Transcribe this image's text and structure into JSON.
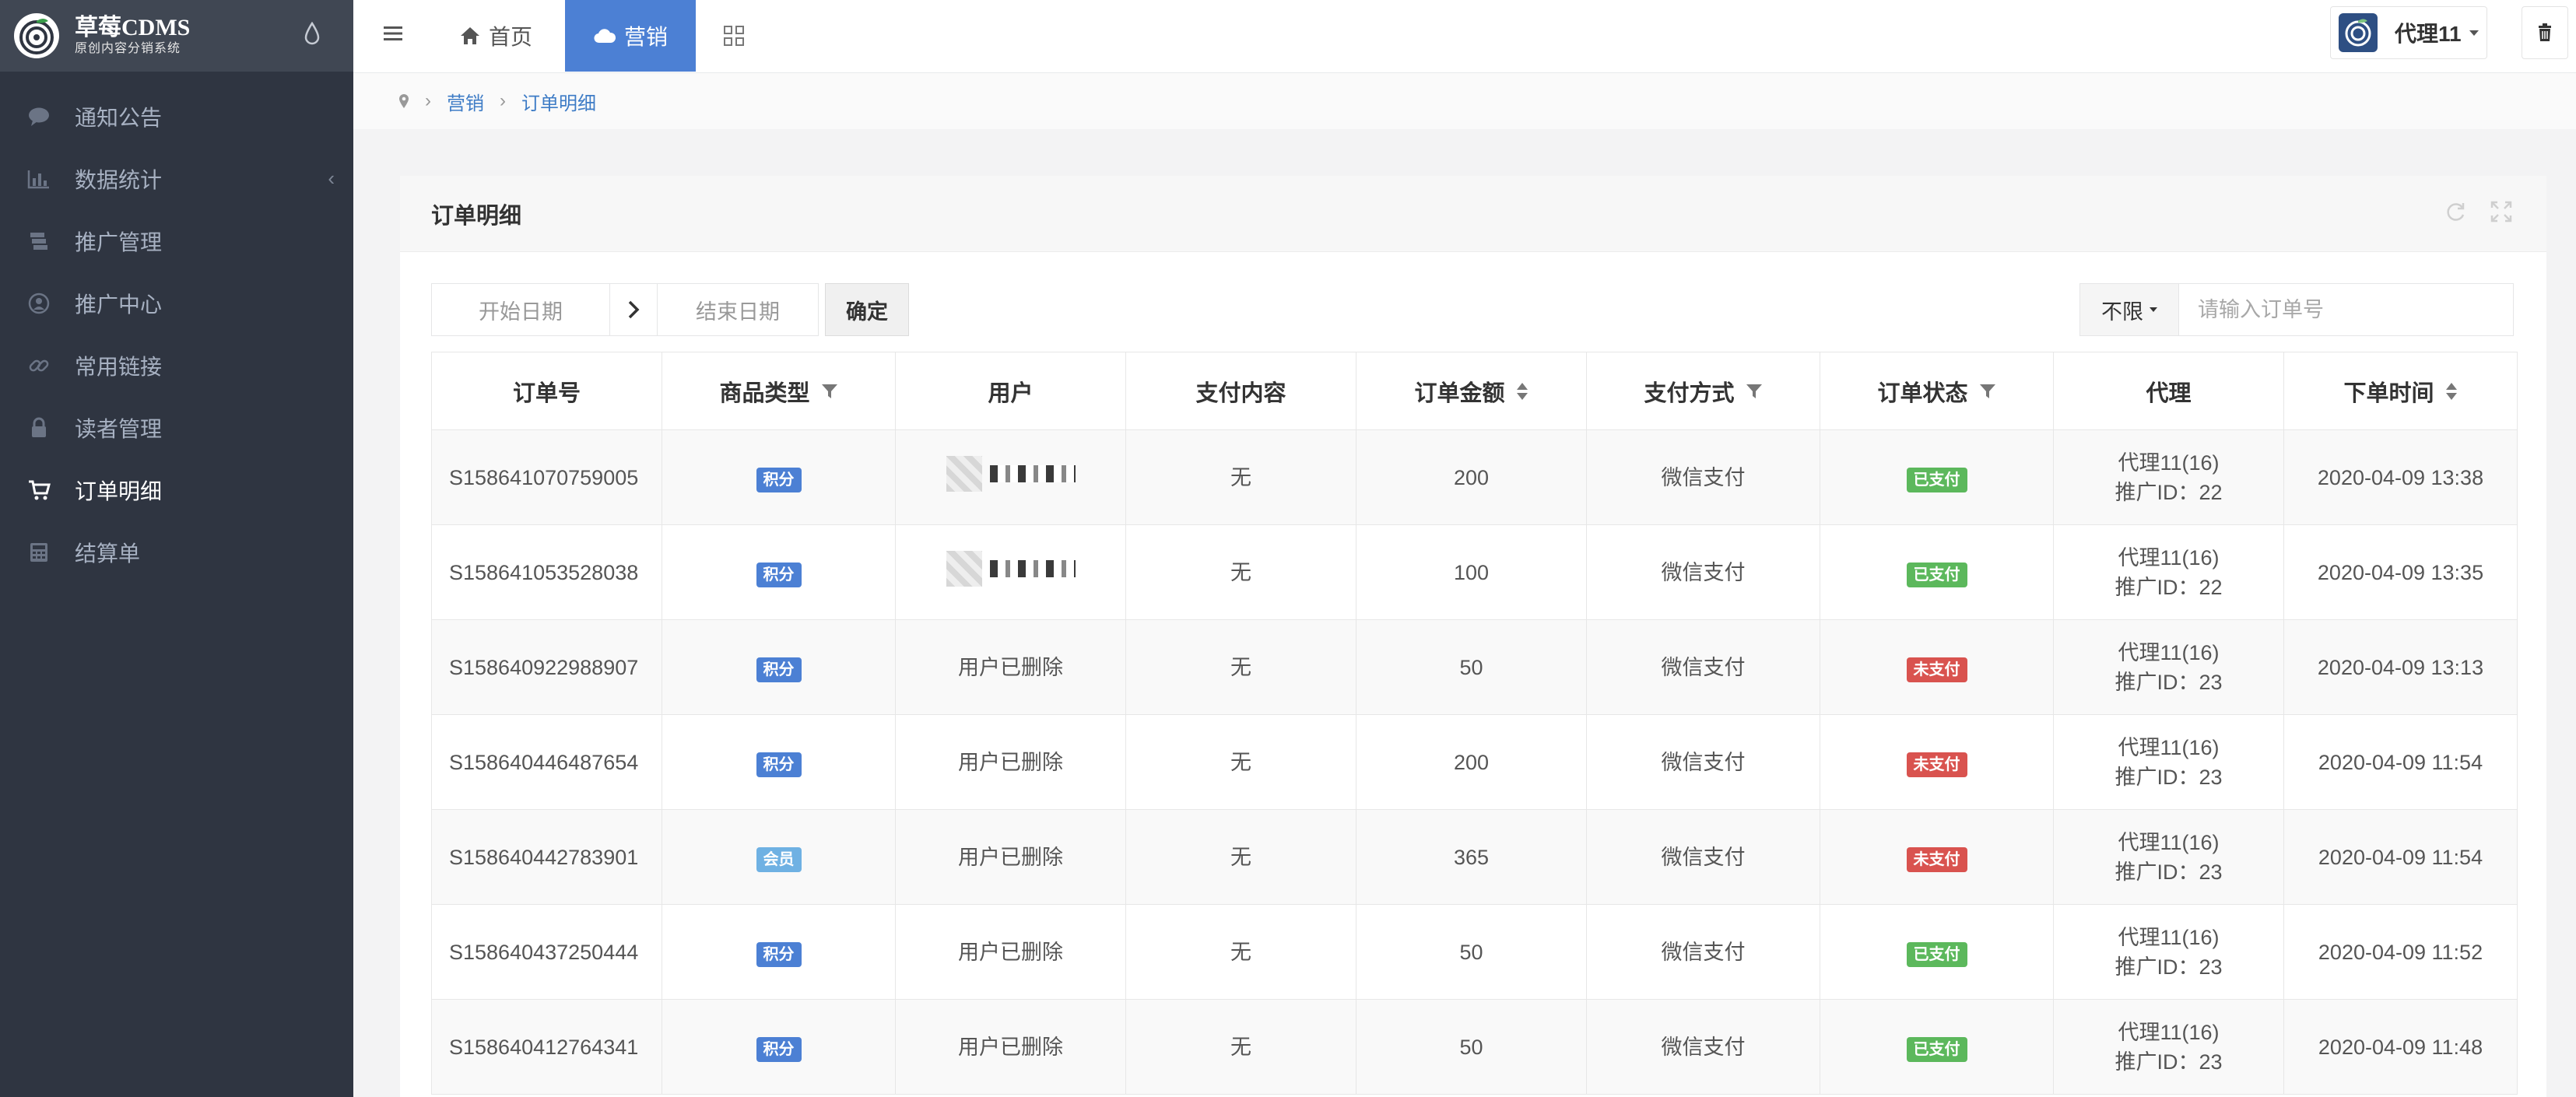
{
  "app": {
    "logo_title": "草莓CDMS",
    "logo_subtitle": "原创内容分销系统"
  },
  "sidebar": {
    "items": [
      {
        "label": "通知公告",
        "icon": "comment-icon",
        "active": false
      },
      {
        "label": "数据统计",
        "icon": "bar-chart-icon",
        "active": false,
        "has_arrow": true
      },
      {
        "label": "推广管理",
        "icon": "stack-icon",
        "active": false
      },
      {
        "label": "推广中心",
        "icon": "user-circle-icon",
        "active": false
      },
      {
        "label": "常用链接",
        "icon": "link-icon",
        "active": false
      },
      {
        "label": "读者管理",
        "icon": "lock-icon",
        "active": false
      },
      {
        "label": "订单明细",
        "icon": "cart-icon",
        "active": true
      },
      {
        "label": "结算单",
        "icon": "calculator-icon",
        "active": false
      }
    ],
    "collapse_arrow": "‹"
  },
  "topbar": {
    "tabs": [
      {
        "label": "首页",
        "icon": "home-icon"
      },
      {
        "label": "营销",
        "icon": "cloud-icon",
        "active": true
      }
    ],
    "user_name": "代理11"
  },
  "breadcrumb": {
    "sep": "›",
    "items": [
      "营销",
      "订单明细"
    ]
  },
  "panel": {
    "title": "订单明细"
  },
  "filters": {
    "start_placeholder": "开始日期",
    "end_placeholder": "结束日期",
    "confirm_label": "确定",
    "select_value": "不限",
    "search_placeholder": "请输入订单号"
  },
  "table": {
    "columns": [
      "订单号",
      "商品类型",
      "用户",
      "支付内容",
      "订单金额",
      "支付方式",
      "订单状态",
      "代理",
      "下单时间"
    ],
    "rows": [
      {
        "order_no": "S158641070759005",
        "type": "积分",
        "user": "",
        "content": "无",
        "amount": "200",
        "pay": "微信支付",
        "status": "已支付",
        "agent": "代理11(16)",
        "promo": "推广ID：22",
        "time": "2020-04-09 13:38"
      },
      {
        "order_no": "S158641053528038",
        "type": "积分",
        "user": "",
        "content": "无",
        "amount": "100",
        "pay": "微信支付",
        "status": "已支付",
        "agent": "代理11(16)",
        "promo": "推广ID：22",
        "time": "2020-04-09 13:35"
      },
      {
        "order_no": "S158640922988907",
        "type": "积分",
        "user": "用户已删除",
        "content": "无",
        "amount": "50",
        "pay": "微信支付",
        "status": "未支付",
        "agent": "代理11(16)",
        "promo": "推广ID：23",
        "time": "2020-04-09 13:13"
      },
      {
        "order_no": "S158640446487654",
        "type": "积分",
        "user": "用户已删除",
        "content": "无",
        "amount": "200",
        "pay": "微信支付",
        "status": "未支付",
        "agent": "代理11(16)",
        "promo": "推广ID：23",
        "time": "2020-04-09 11:54"
      },
      {
        "order_no": "S158640442783901",
        "type": "会员",
        "user": "用户已删除",
        "content": "无",
        "amount": "365",
        "pay": "微信支付",
        "status": "未支付",
        "agent": "代理11(16)",
        "promo": "推广ID：23",
        "time": "2020-04-09 11:54"
      },
      {
        "order_no": "S158640437250444",
        "type": "积分",
        "user": "用户已删除",
        "content": "无",
        "amount": "50",
        "pay": "微信支付",
        "status": "已支付",
        "agent": "代理11(16)",
        "promo": "推广ID：23",
        "time": "2020-04-09 11:52"
      },
      {
        "order_no": "S158640412764341",
        "type": "积分",
        "user": "用户已删除",
        "content": "无",
        "amount": "50",
        "pay": "微信支付",
        "status": "已支付",
        "agent": "代理11(16)",
        "promo": "推广ID：23",
        "time": "2020-04-09 11:48"
      }
    ]
  },
  "colors": {
    "sidebar_bg": "#2f3541",
    "accent": "#4c80d4",
    "badge_points": "#4c80d4",
    "badge_member": "#6fb1e3",
    "status_paid": "#5cb85c",
    "status_unpaid": "#d9534f"
  }
}
